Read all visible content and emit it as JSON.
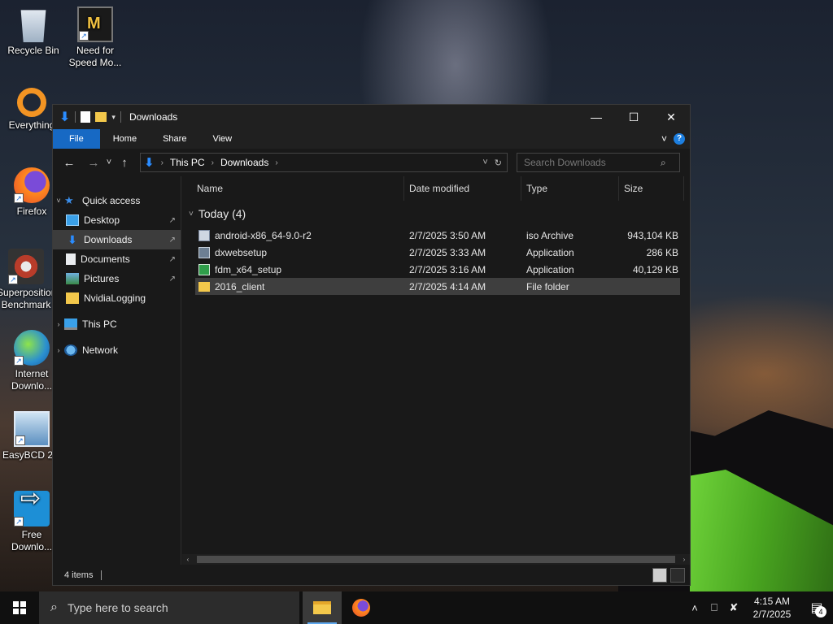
{
  "desktop": {
    "icons": [
      {
        "label": "Recycle Bin",
        "icon": "recycle-bin-icon"
      },
      {
        "label": "Need for Speed Mo...",
        "icon": "need-for-speed-icon"
      },
      {
        "label": "Everything",
        "icon": "everything-icon"
      },
      {
        "label": "Firefox",
        "icon": "firefox-icon"
      },
      {
        "label": "Superposition Benchmark",
        "icon": "superposition-icon"
      },
      {
        "label": "Internet Downlo...",
        "icon": "internet-download-manager-icon"
      },
      {
        "label": "EasyBCD 2...",
        "icon": "easybcd-icon"
      },
      {
        "label": "Free Downlo...",
        "icon": "free-download-manager-icon"
      }
    ],
    "shortcut_glyph": "↗"
  },
  "window": {
    "title": "Downloads",
    "controls": {
      "minimize": "—",
      "maximize": "☐",
      "close": "✕"
    },
    "quick_access_toolbar": {
      "caret": "▾"
    },
    "ribbon": {
      "tabs": [
        "File",
        "Home",
        "Share",
        "View"
      ],
      "expand": "˅",
      "help": "?"
    },
    "nav_buttons": {
      "back": "←",
      "forward": "→",
      "recent": "˅",
      "up": "↑"
    },
    "address": {
      "crumbs": [
        "This PC",
        "Downloads"
      ],
      "separator": "›",
      "dropdown": "˅",
      "refresh": "↻"
    },
    "search": {
      "placeholder": "Search Downloads",
      "icon": "search-icon"
    },
    "nav_pane": {
      "quick_access": "Quick access",
      "items": [
        {
          "label": "Desktop",
          "icon": "desktop-icon",
          "pinned": true
        },
        {
          "label": "Downloads",
          "icon": "downloads-icon",
          "pinned": true,
          "selected": true
        },
        {
          "label": "Documents",
          "icon": "documents-icon",
          "pinned": true
        },
        {
          "label": "Pictures",
          "icon": "pictures-icon",
          "pinned": true
        },
        {
          "label": "NvidiaLogging",
          "icon": "folder-icon",
          "pinned": false
        }
      ],
      "this_pc": "This PC",
      "network": "Network",
      "expander": "›",
      "expanded": "˅",
      "pin_glyph": "📌"
    },
    "columns": {
      "name": "Name",
      "date": "Date modified",
      "type": "Type",
      "size": "Size"
    },
    "group": {
      "label": "Today (4)",
      "chevron": "˅"
    },
    "files": [
      {
        "name": "android-x86_64-9.0-r2",
        "date": "2/7/2025 3:50 AM",
        "type": "iso Archive",
        "size": "943,104 KB",
        "icon": "iso-file-icon"
      },
      {
        "name": "dxwebsetup",
        "date": "2/7/2025 3:33 AM",
        "type": "Application",
        "size": "286 KB",
        "icon": "application-icon"
      },
      {
        "name": "fdm_x64_setup",
        "date": "2/7/2025 3:16 AM",
        "type": "Application",
        "size": "40,129 KB",
        "icon": "installer-icon"
      },
      {
        "name": "2016_client",
        "date": "2/7/2025 4:14 AM",
        "type": "File folder",
        "size": "",
        "icon": "folder-icon",
        "selected": true
      }
    ],
    "status": {
      "items": "4 items"
    },
    "scroll": {
      "left": "‹",
      "right": "›"
    }
  },
  "taskbar": {
    "search_placeholder": "Type here to search",
    "apps": [
      "file-explorer-icon",
      "firefox-icon"
    ],
    "tray": {
      "chevron": "˄",
      "network": "⎕",
      "volume": "✘"
    },
    "time": "4:15 AM",
    "date": "2/7/2025",
    "notifications": "4"
  }
}
